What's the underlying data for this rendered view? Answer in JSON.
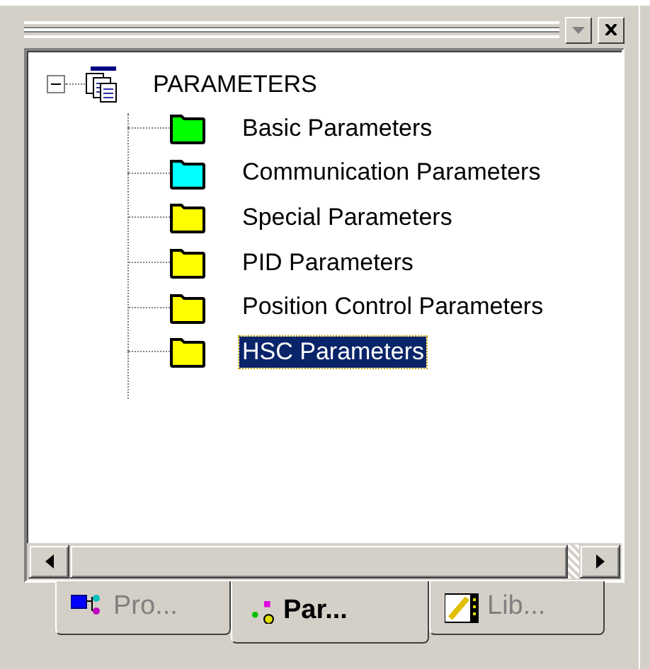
{
  "tree": {
    "label": "PARAMETERS",
    "expanded": true,
    "children": [
      {
        "label": "Basic Parameters",
        "color": "#00ff00",
        "selected": false
      },
      {
        "label": "Communication Parameters",
        "color": "#00ffff",
        "selected": false
      },
      {
        "label": "Special Parameters",
        "color": "#ffff00",
        "selected": false
      },
      {
        "label": "PID Parameters",
        "color": "#ffff00",
        "selected": false
      },
      {
        "label": "Position Control Parameters",
        "color": "#ffff00",
        "selected": false
      },
      {
        "label": "HSC Parameters",
        "color": "#ffff00",
        "selected": true
      }
    ]
  },
  "tabs": [
    {
      "label": "Pro...",
      "selected": false
    },
    {
      "label": "Par...",
      "selected": true
    },
    {
      "label": "Lib...",
      "selected": false
    }
  ]
}
